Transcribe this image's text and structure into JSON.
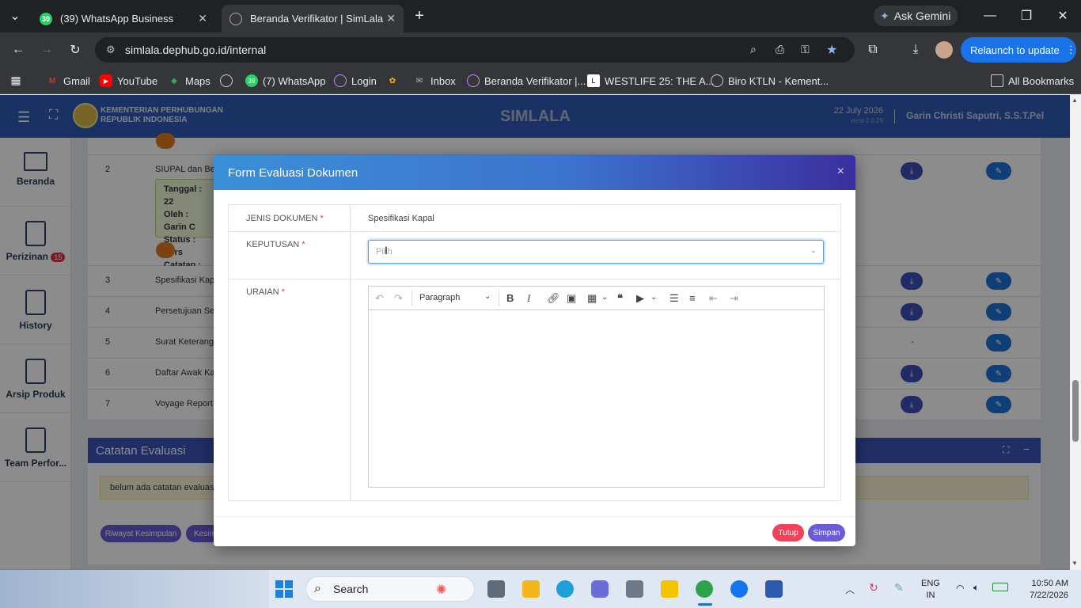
{
  "browser": {
    "tabs": [
      {
        "label": "(39) WhatsApp Business",
        "badge": "39"
      },
      {
        "label": "Beranda Verifikator | SimLala"
      }
    ],
    "url": "simlala.dephub.go.id/internal",
    "gemini": "Ask Gemini",
    "relaunch": "Relaunch to update",
    "bookmarks": [
      "Gmail",
      "YouTube",
      "Maps",
      "(7) WhatsApp",
      "Login",
      "Inbox",
      "Beranda Verifikator |...",
      "WESTLIFE 25: THE A...",
      "Biro KTLN - Kement..."
    ],
    "all_bookmarks": "All Bookmarks"
  },
  "app": {
    "org_line1": "KEMENTERIAN PERHUBUNGAN",
    "org_line2": "REPUBLIK INDONESIA",
    "title": "SIMLALA",
    "date": "22 July 2026",
    "version": "versi 2.0.29",
    "user": "Garin Christi Saputri, S.S.T.Pel"
  },
  "sidebar": [
    {
      "label": "Beranda"
    },
    {
      "label": "Perizinan",
      "badge": "15"
    },
    {
      "label": "History"
    },
    {
      "label": "Arsip Produk"
    },
    {
      "label": "Team Perfor..."
    }
  ],
  "table_rows": [
    {
      "no": "2",
      "name": "SIUPAL dan Beri",
      "has_download": true
    },
    {
      "no": "3",
      "name": "Spesifikasi Kapa",
      "has_download": true
    },
    {
      "no": "4",
      "name": "Persetujuan Seb",
      "has_download": true
    },
    {
      "no": "5",
      "name": "Surat Keterangan",
      "download_text": "-"
    },
    {
      "no": "6",
      "name": "Daftar Awak Kap",
      "has_download": true
    },
    {
      "no": "7",
      "name": "Voyage Report (",
      "has_download": true
    }
  ],
  "row2_detail": {
    "tanggal": "Tanggal : 22",
    "oleh": "Oleh : Garin C",
    "status": "Status : Pers",
    "catatan": "Catatan : ses"
  },
  "catatan_section": {
    "title": "Catatan Evaluasi",
    "empty_text": "belum ada catatan evaluasi",
    "btn_riwayat": "Riwayat Kesimpulan",
    "btn_kesim": "Kesim"
  },
  "modal": {
    "title": "Form Evaluasi Dokumen",
    "close": "×",
    "jenis_label": "JENIS DOKUMEN",
    "jenis_value": "Spesifikasi Kapal",
    "keputusan_label": "KEPUTUSAN",
    "keputusan_placeholder": "Pilih",
    "uraian_label": "URAIAN",
    "required_mark": "*",
    "editor_format": "Paragraph",
    "btn_tutup": "Tutup",
    "btn_simpan": "Simpan"
  },
  "taskbar": {
    "search_placeholder": "Search",
    "lang1": "ENG",
    "lang2": "IN",
    "time": "10:50 AM",
    "date": "7/22/2026"
  },
  "colors": {
    "header": "#2f5bb4",
    "tutup": "#f0435a",
    "simpan": "#6a5bd8"
  }
}
